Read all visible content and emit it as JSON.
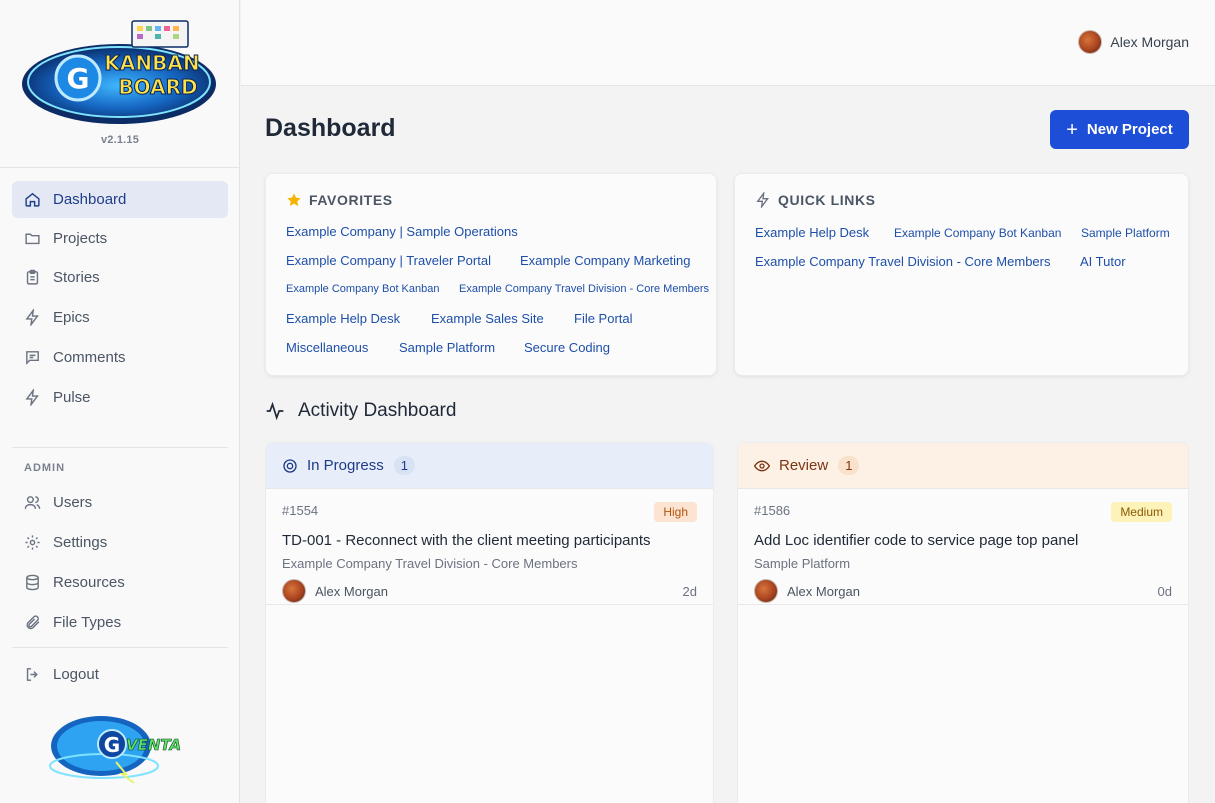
{
  "app": {
    "version": "v2.1.15",
    "logo_text_line1": "KANBAN",
    "logo_text_line2": "BOARD",
    "logo_letter": "G",
    "footer_logo_text": "VENTA"
  },
  "sidebar": {
    "items": [
      {
        "label": "Dashboard",
        "icon": "home-icon",
        "active": true
      },
      {
        "label": "Projects",
        "icon": "folder-icon"
      },
      {
        "label": "Stories",
        "icon": "clipboard-icon"
      },
      {
        "label": "Epics",
        "icon": "bolt-icon"
      },
      {
        "label": "Comments",
        "icon": "comment-icon"
      },
      {
        "label": "Pulse",
        "icon": "bolt-icon"
      }
    ],
    "admin_label": "ADMIN",
    "admin_items": [
      {
        "label": "Users",
        "icon": "users-icon"
      },
      {
        "label": "Settings",
        "icon": "gear-icon"
      },
      {
        "label": "Resources",
        "icon": "database-icon"
      },
      {
        "label": "File Types",
        "icon": "paperclip-icon"
      }
    ],
    "logout_label": "Logout"
  },
  "topbar": {
    "user_name": "Alex Morgan"
  },
  "page": {
    "title": "Dashboard",
    "new_project_label": "New Project"
  },
  "favorites": {
    "title": "FAVORITES",
    "links": [
      "Example Company | Sample Operations",
      "Example Company | Traveler Portal",
      "Example Company Marketing",
      "Example Company Bot Kanban",
      "Example Company Travel Division - Core Members",
      "Example Help Desk",
      "Example Sales Site",
      "File Portal",
      "Miscellaneous",
      "Sample Platform",
      "Secure Coding"
    ]
  },
  "quick_links": {
    "title": "QUICK LINKS",
    "links": [
      "Example Help Desk",
      "Example Company Bot Kanban",
      "Sample Platform",
      "Example Company Travel Division - Core Members",
      "AI Tutor"
    ]
  },
  "activity": {
    "title": "Activity Dashboard",
    "columns": [
      {
        "name": "In Progress",
        "count": "1",
        "task": {
          "id": "#1554",
          "priority": "High",
          "title": "TD-001 - Reconnect with the client meeting participants",
          "project": "Example Company Travel Division - Core Members",
          "assignee": "Alex Morgan",
          "age": "2d"
        }
      },
      {
        "name": "Review",
        "count": "1",
        "task": {
          "id": "#1586",
          "priority": "Medium",
          "title": "Add Loc identifier code to service page top panel",
          "project": "Sample Platform",
          "assignee": "Alex Morgan",
          "age": "0d"
        }
      }
    ]
  },
  "colors": {
    "primary": "#1d4ed8",
    "link": "#1e4fa8",
    "active_nav_bg": "#e3e8f4",
    "star": "#f5b400",
    "high_bg": "#fde4d2",
    "medium_bg": "#fdf2b8"
  }
}
